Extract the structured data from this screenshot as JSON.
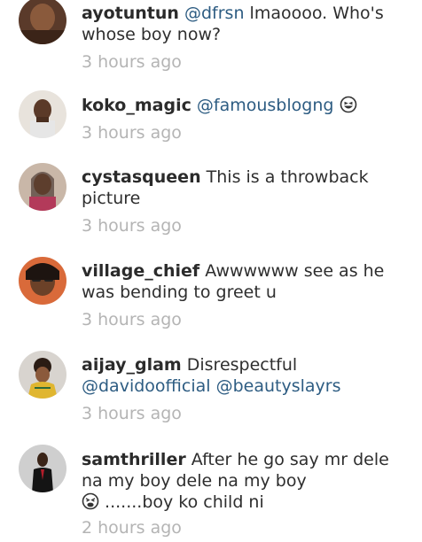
{
  "comments": [
    {
      "username": "ayotuntun",
      "mention": "@dfrsn",
      "text": " lmaoooo. Who's whose boy now?",
      "time": "3 hours ago",
      "avatar": "avatar-ayotuntun"
    },
    {
      "username": "koko_magic",
      "mention": "@famousblogng",
      "text": "",
      "emoji": "grinning-squint-face-icon",
      "time": "3 hours ago",
      "avatar": "avatar-koko-magic"
    },
    {
      "username": "cystasqueen",
      "text": " This is a throwback picture",
      "time": "3 hours ago",
      "avatar": "avatar-cystasqueen"
    },
    {
      "username": "village_chief",
      "text": " Awwwwww see as he was bending to greet u",
      "time": "3 hours ago",
      "avatar": "avatar-village-chief"
    },
    {
      "username": "aijay_glam",
      "text": " Disrespectful",
      "mention": "@davidoofficial",
      "mention2": "@beautyslayrs",
      "time": "3 hours ago",
      "avatar": "avatar-aijay-glam"
    },
    {
      "username": "samthriller",
      "text": " After he go say mr dele na my boy dele na my boy",
      "emoji": "tired-face-icon",
      "text2": ".......boy ko child ni",
      "time": "2 hours ago",
      "avatar": "avatar-samthriller"
    }
  ],
  "colors": {
    "username": "#2b2b2b",
    "mention": "#2d5c82",
    "body_text": "#2e2e2e",
    "timestamp": "#b4b4b4",
    "background": "#ffffff"
  }
}
